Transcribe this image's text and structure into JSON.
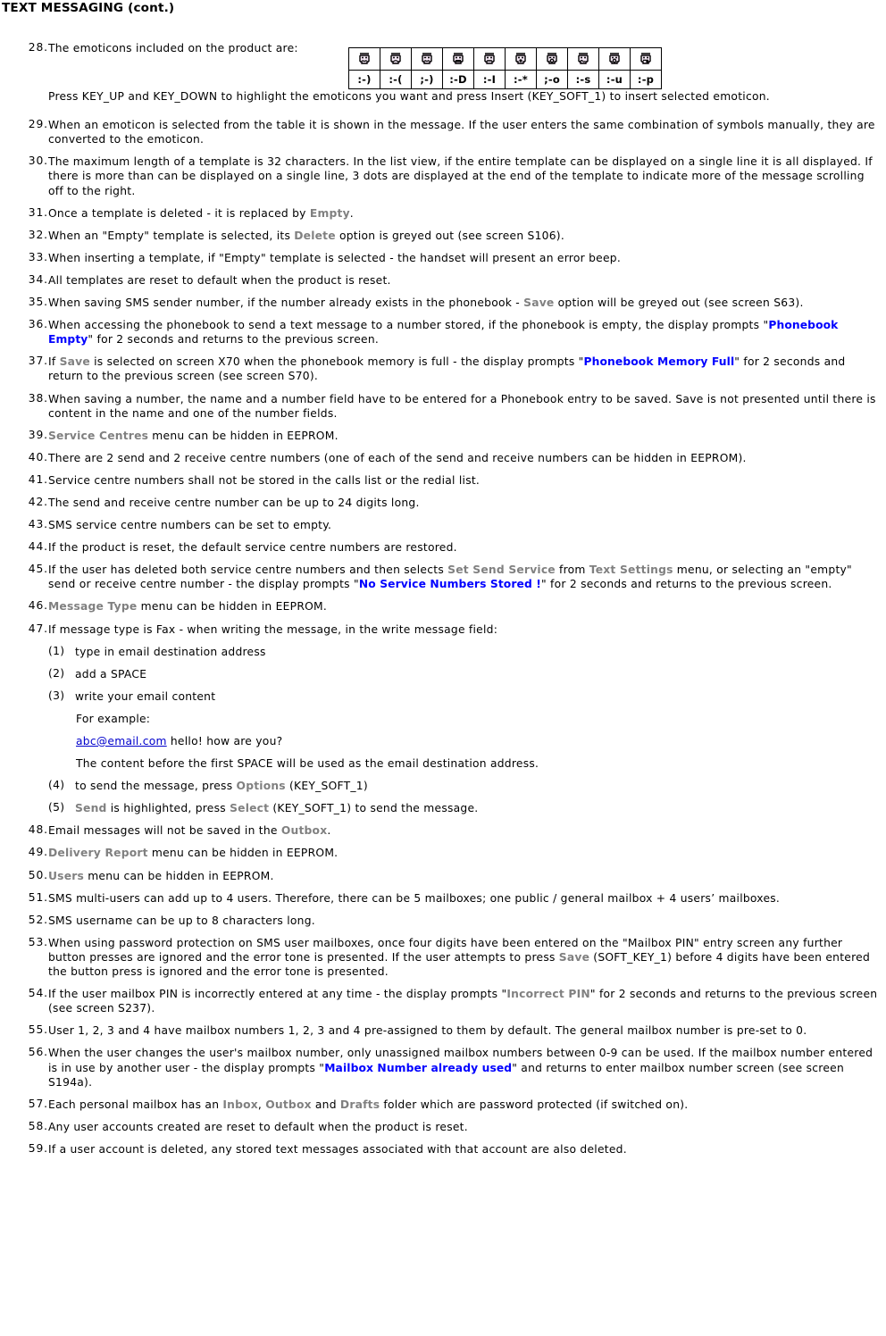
{
  "document": {
    "title": "TEXT MESSAGING (cont.)"
  },
  "colors": {
    "ui_option_grey": "#808080",
    "display_prompt_blue": "#0000ff",
    "hyperlink_blue": "#0000cc",
    "text_black": "#000000"
  },
  "emoticon_table": {
    "caption_item": "28",
    "columns": [
      {
        "icon": "smiley-smile-icon",
        "code": ":-)"
      },
      {
        "icon": "smiley-frown-icon",
        "code": ":-("
      },
      {
        "icon": "smiley-wink-icon",
        "code": ";-)"
      },
      {
        "icon": "smiley-grin-icon",
        "code": ":-D"
      },
      {
        "icon": "smiley-neutral-icon",
        "code": ":-I"
      },
      {
        "icon": "smiley-kiss-icon",
        "code": ":-*"
      },
      {
        "icon": "smiley-wink-shock-icon",
        "code": ";-o"
      },
      {
        "icon": "smiley-sad-icon",
        "code": ":-s"
      },
      {
        "icon": "smiley-surprise-icon",
        "code": ":-u"
      },
      {
        "icon": "smiley-tongue-icon",
        "code": ":-p"
      }
    ]
  },
  "items": {
    "n28": {
      "num": "28.",
      "text": "The emoticons included on the product are:"
    },
    "p28": {
      "text": "Press KEY_UP and KEY_DOWN to highlight the emoticons you want and press Insert (KEY_SOFT_1) to insert selected emoticon."
    },
    "n29": {
      "num": "29.",
      "text": "When an emoticon is selected from the table it is shown in the message. If the user enters the same combination of symbols manually, they are converted to the emoticon."
    },
    "n30": {
      "num": "30.",
      "text": "The maximum length of a template is 32 characters. In the list view, if the entire template can be displayed on a single line it is all displayed. If there is more than can be displayed on a single line, 3 dots are displayed at the end of the template to indicate more of the message scrolling off to the right."
    },
    "n31": {
      "num": "31.",
      "a": "Once a template is deleted - it is replaced by ",
      "b": "Empty",
      "c": "."
    },
    "n32": {
      "num": "32.",
      "a": "When an \"Empty\" template is selected, its ",
      "b": "Delete",
      "c": " option is greyed out (see screen S106)."
    },
    "n33": {
      "num": "33.",
      "text": "When inserting a template, if \"Empty\" template is selected - the handset will present an error beep."
    },
    "n34": {
      "num": "34.",
      "text": "All templates are reset to default when the product is reset."
    },
    "n35": {
      "num": "35.",
      "a": "When saving SMS sender number, if the number already exists in the phonebook - ",
      "b": "Save",
      "c": " option will be greyed out (see screen S63)."
    },
    "n36": {
      "num": "36.",
      "a": "When accessing the phonebook to send a text message to a number stored, if the phonebook is empty, the display prompts \"",
      "b": "Phonebook Empty",
      "c": "\" for 2 seconds and returns to the previous screen."
    },
    "n37": {
      "num": "37.",
      "a": "If ",
      "b": "Save",
      "c": " is selected on screen X70 when the phonebook memory is full - the display prompts \"",
      "d": "Phonebook Memory Full",
      "e": "\" for 2 seconds and return to the previous screen (see screen S70)."
    },
    "n38": {
      "num": "38.",
      "text": "When saving a number, the name and a number field have to be entered for a Phonebook entry to be saved. Save is not presented until there is content in the name and one of the number fields."
    },
    "n39": {
      "num": "39.",
      "a": "Service Centres",
      "b": " menu can be hidden in EEPROM."
    },
    "n40": {
      "num": "40.",
      "text": "There are 2 send and 2 receive centre numbers (one of each of the send and receive numbers can be hidden in EEPROM)."
    },
    "n41": {
      "num": "41.",
      "text": "Service centre numbers shall not be stored in the calls list or the redial list."
    },
    "n42": {
      "num": "42.",
      "text": "The send and receive centre number can be up to 24 digits long."
    },
    "n43": {
      "num": "43.",
      "text": "SMS service centre numbers can be set to empty."
    },
    "n44": {
      "num": "44.",
      "text": "If the product is reset, the default service centre numbers are restored."
    },
    "n45": {
      "num": "45.",
      "a": "If the user has deleted both service centre numbers and then selects ",
      "b": "Set Send Service",
      "c": " from ",
      "d": "Text Settings",
      "e": " menu, or selecting an \"empty\" send or receive centre number - the display prompts \"",
      "f": "No Service Numbers Stored !",
      "g": "\"  for 2 seconds and returns to the previous screen."
    },
    "n46": {
      "num": "46.",
      "a": "Message Type",
      "b": " menu can be hidden in EEPROM."
    },
    "n47": {
      "num": "47.",
      "text": "If message type is Fax - when writing the message, in the write message field:"
    },
    "s1": {
      "num": "(1)",
      "text": "type in email destination address"
    },
    "s2": {
      "num": "(2)",
      "text": "add a SPACE"
    },
    "s3": {
      "num": "(3)",
      "text": "write your email content"
    },
    "p_example": {
      "text": "For example:"
    },
    "p_email": {
      "link": "abc@email.com",
      "rest": " hello! how are you?"
    },
    "p_content": {
      "text": "The content before the first SPACE will be used as the email destination address."
    },
    "s4": {
      "num": "(4)",
      "a": "to send the message, press ",
      "b": "Options",
      "c": " (KEY_SOFT_1)"
    },
    "s5": {
      "num": "(5)",
      "a": "",
      "b": "Send",
      "c": " is highlighted, press ",
      "d": "Select",
      "e": " (KEY_SOFT_1) to send the message."
    },
    "n48": {
      "num": "48.",
      "a": "Email messages will not be saved in the ",
      "b": "Outbox",
      "c": "."
    },
    "n49": {
      "num": "49.",
      "a": "Delivery Report",
      "b": " menu can be hidden in EEPROM."
    },
    "n50": {
      "num": "50.",
      "a": "Users",
      "b": " menu can be hidden in EEPROM."
    },
    "n51": {
      "num": "51.",
      "text": "SMS multi-users can add up to 4 users. Therefore, there can be 5 mailboxes; one public / general mailbox + 4 users’ mailboxes."
    },
    "n52": {
      "num": "52.",
      "text": "SMS username can be up to 8 characters long."
    },
    "n53": {
      "num": "53.",
      "a": "When using password protection on SMS user mailboxes, once four digits have been entered on the \"Mailbox PIN\" entry screen any further button presses are ignored and the error tone is presented. If the user attempts to press ",
      "b": "Save",
      "c": " (SOFT_KEY_1) before 4 digits have been entered the button press is ignored and the error tone is presented."
    },
    "n54": {
      "num": "54.",
      "a": "If the user mailbox PIN is incorrectly entered at any time - the display prompts \"",
      "b": "Incorrect PIN",
      "c": "\" for 2 seconds and returns to the previous screen (see screen S237)."
    },
    "n55": {
      "num": "55.",
      "text": "User 1, 2, 3 and 4 have mailbox numbers 1, 2, 3 and 4 pre-assigned to them by default. The general mailbox number is pre-set to 0."
    },
    "n56": {
      "num": "56.",
      "a": "When the user changes the user's mailbox number, only unassigned mailbox numbers between 0-9 can be used. If the mailbox number entered is in use by another user - the display prompts \"",
      "b": "Mailbox Number already used",
      "c": "\" and returns to enter mailbox number screen (see screen S194a)."
    },
    "n57": {
      "num": "57.",
      "a": "Each personal mailbox has an ",
      "b": "Inbox",
      "c": ", ",
      "d": "Outbox",
      "e": " and ",
      "f": "Drafts",
      "g": " folder which are password protected (if switched on)."
    },
    "n58": {
      "num": "58.",
      "text": "Any user accounts created are reset to default when the product is reset."
    },
    "n59": {
      "num": "59.",
      "text": "If a user account is deleted, any stored text messages associated with that account are also deleted."
    }
  }
}
